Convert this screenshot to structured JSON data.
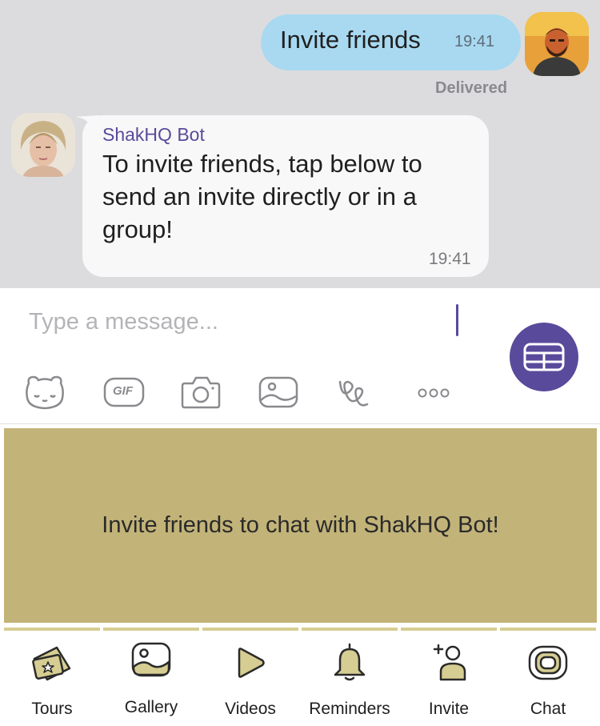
{
  "chat": {
    "outgoing": {
      "text": "Invite friends",
      "time": "19:41",
      "status": "Delivered"
    },
    "incoming": {
      "sender": "ShakHQ Bot",
      "text": "To invite friends, tap below to send an invite directly or in a group!",
      "time": "19:41"
    }
  },
  "composer": {
    "placeholder": "Type a message...",
    "tools": [
      "sticker-icon",
      "gif-icon",
      "camera-icon",
      "gallery-icon",
      "doodle-icon",
      "more-icon"
    ],
    "gif_label": "GIF",
    "keyboard_button": "bot-keyboard-icon"
  },
  "banner": {
    "text": "Invite friends to chat with ShakHQ Bot!",
    "color": "#c2b378"
  },
  "nav": {
    "items": [
      {
        "label": "Tours",
        "icon": "ticket-icon"
      },
      {
        "label": "Gallery",
        "icon": "image-icon"
      },
      {
        "label": "Videos",
        "icon": "play-icon"
      },
      {
        "label": "Reminders",
        "icon": "bell-icon"
      },
      {
        "label": "Invite",
        "icon": "add-person-icon"
      },
      {
        "label": "Chat",
        "icon": "chat-bubble-icon"
      }
    ]
  },
  "colors": {
    "accent": "#5a4a9b",
    "outgoing_bubble": "#a8d9f1",
    "gold": "#d6cd92"
  }
}
